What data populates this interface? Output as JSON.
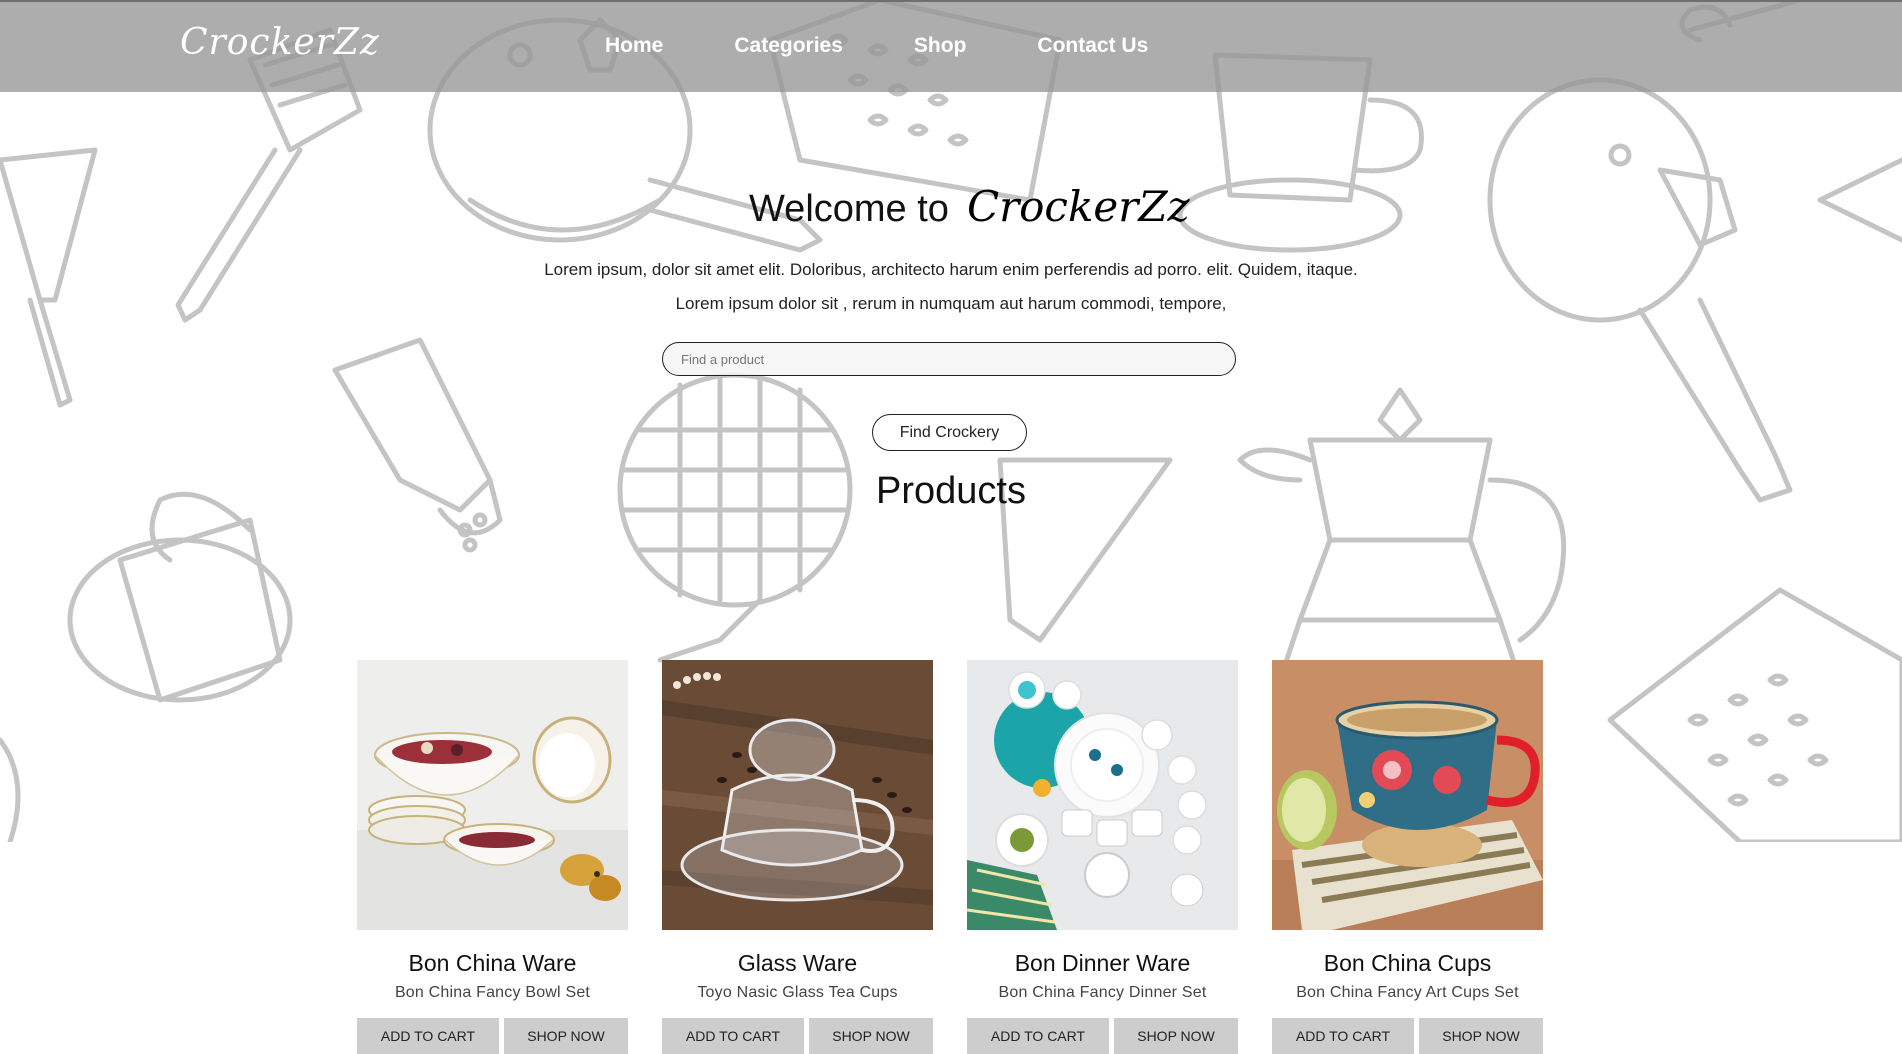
{
  "header": {
    "logo": "CrockerZz",
    "nav": [
      "Home",
      "Categories",
      "Shop",
      "Contact Us"
    ]
  },
  "hero": {
    "welcome": "Welcome to",
    "brand": "CrockerZz",
    "line1": "Lorem ipsum, dolor sit amet elit. Doloribus, architecto harum enim perferendis ad porro. elit. Quidem, itaque.",
    "line2": "Lorem ipsum dolor sit , rerum in numquam aut harum commodi, tempore,",
    "search_placeholder": "Find a product",
    "find_button": "Find Crockery"
  },
  "products": {
    "title": "Products",
    "items": [
      {
        "name": "Bon China Ware",
        "desc": "Bon China Fancy Bowl Set",
        "add": "ADD TO CART",
        "shop": "SHOP NOW"
      },
      {
        "name": "Glass Ware",
        "desc": "Toyo Nasic Glass Tea Cups",
        "add": "ADD TO CART",
        "shop": "SHOP NOW"
      },
      {
        "name": "Bon Dinner Ware",
        "desc": "Bon China Fancy Dinner Set",
        "add": "ADD TO CART",
        "shop": "SHOP NOW"
      },
      {
        "name": "Bon China Cups",
        "desc": "Bon China Fancy Art Cups Set",
        "add": "ADD TO CART",
        "shop": "SHOP NOW"
      }
    ]
  },
  "colors": {
    "header_bg": "#a0a0a0",
    "doodle_stroke": "#c4c4c4",
    "button_bg": "#cdcdcd"
  }
}
